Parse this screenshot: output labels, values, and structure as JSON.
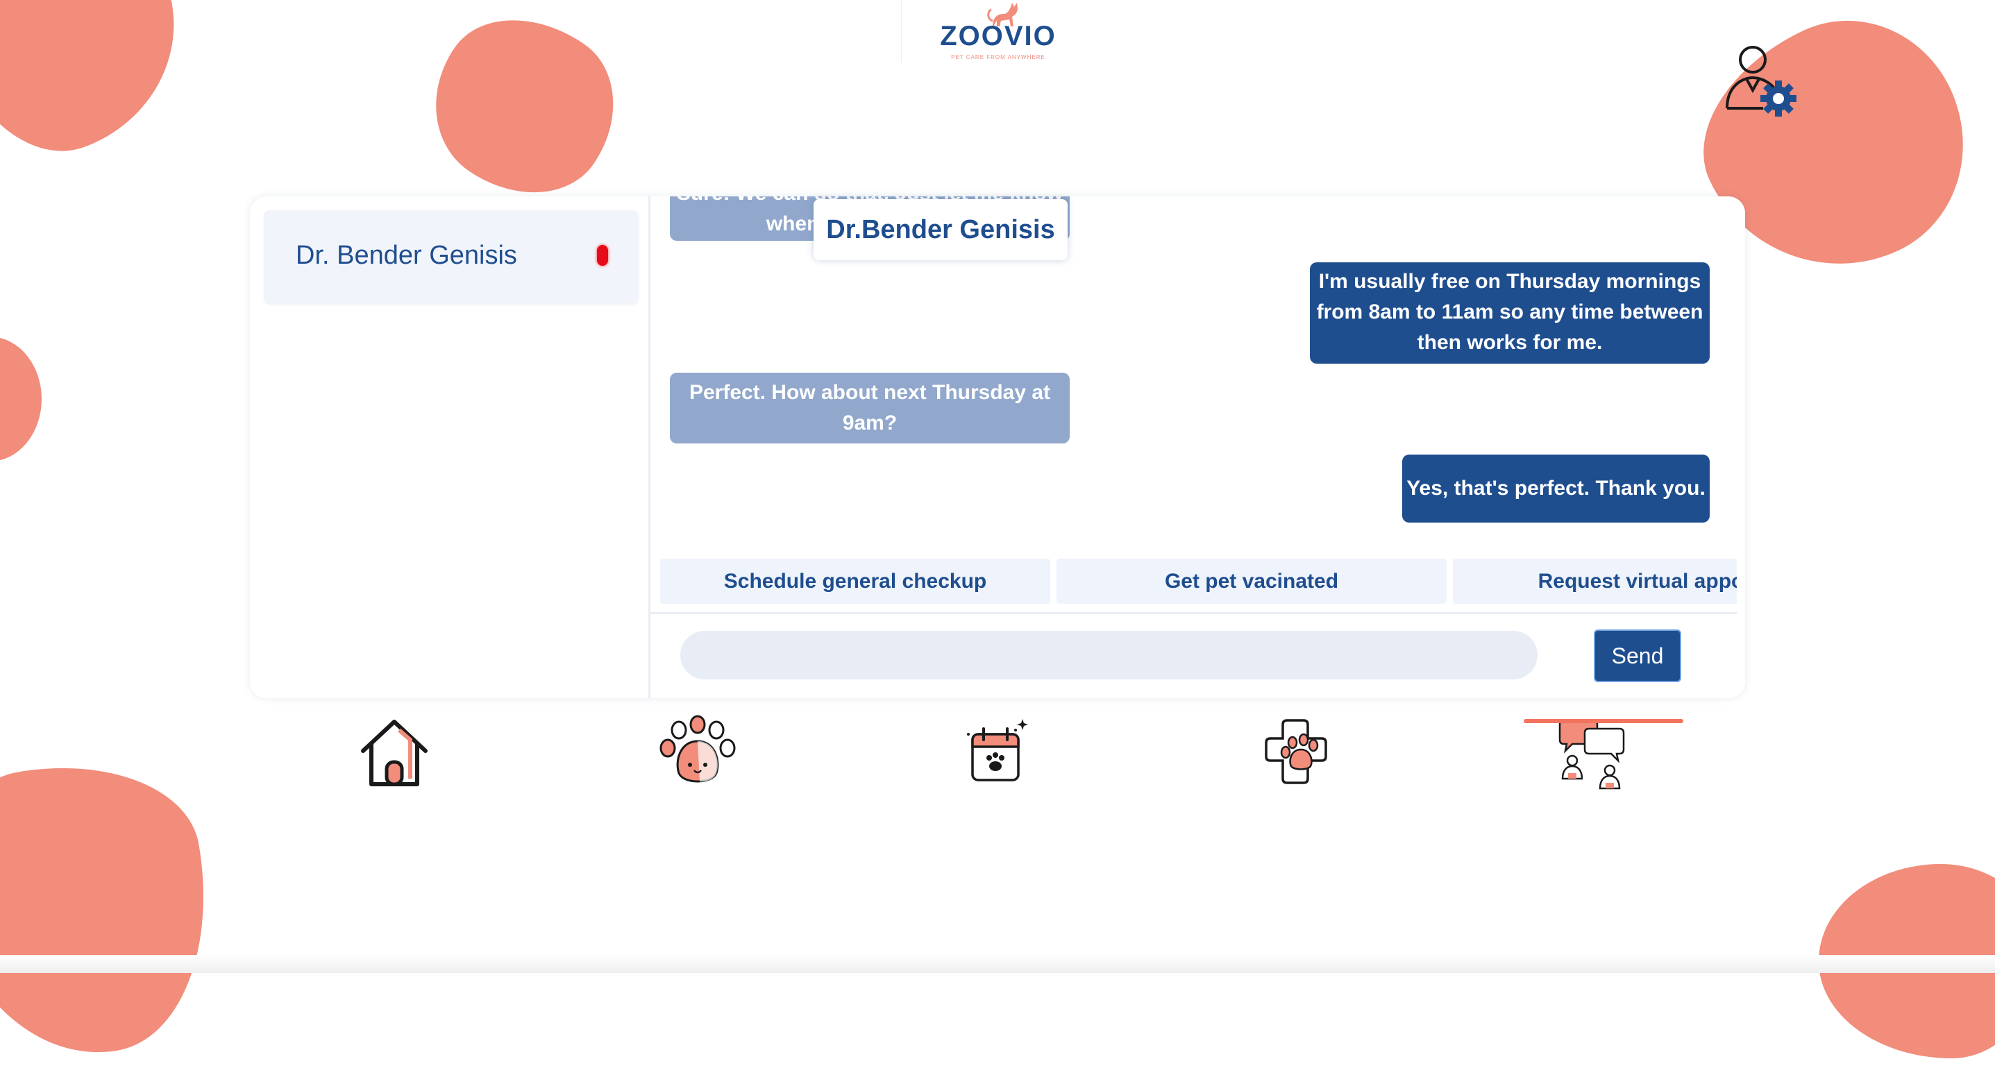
{
  "brand": {
    "name": "ZOOVIO",
    "tagline": "PET CARE FROM ANYWHERE",
    "accent": "#f28c7b",
    "primary": "#1f4e8f"
  },
  "header": {
    "profile_icon": "user-gear-icon"
  },
  "contacts": [
    {
      "name": "Dr. Bender Genisis",
      "unread": true
    }
  ],
  "chat": {
    "header_name": "Dr.Bender Genisis",
    "messages": [
      {
        "from": "doctor",
        "text": "Sure! We can do that. Just let me know when is best for you."
      },
      {
        "from": "user",
        "text": "I'm usually free on Thursday mornings from 8am to 11am so any time between then works for me."
      },
      {
        "from": "doctor",
        "text": "Perfect. How about next Thursday at 9am?"
      },
      {
        "from": "user",
        "text": "Yes, that's perfect. Thank you."
      }
    ],
    "quick_replies": [
      "Schedule general checkup",
      "Get pet vacinated",
      "Request virtual appoir"
    ],
    "input_value": "",
    "send_label": "Send"
  },
  "nav": {
    "items": [
      {
        "id": "home",
        "icon": "house-icon"
      },
      {
        "id": "pets",
        "icon": "paw-icon"
      },
      {
        "id": "appointments",
        "icon": "calendar-paw-icon"
      },
      {
        "id": "health",
        "icon": "medical-paw-icon"
      },
      {
        "id": "chat",
        "icon": "chat-people-icon",
        "active": true
      }
    ]
  }
}
